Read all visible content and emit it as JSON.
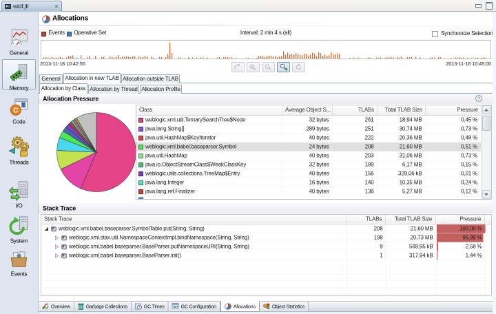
{
  "window": {
    "tab_title": "wldf.jfr"
  },
  "sidebar": {
    "items": [
      {
        "label": "General",
        "selected": false
      },
      {
        "label": "Memory",
        "selected": true
      },
      {
        "label": "Code",
        "selected": false
      },
      {
        "label": "Threads",
        "selected": false
      },
      {
        "label": "I/O",
        "selected": false
      },
      {
        "label": "System",
        "selected": false
      },
      {
        "label": "Events",
        "selected": false
      }
    ]
  },
  "header": {
    "title": "Allocations"
  },
  "timeline": {
    "events_label": "Events",
    "operative_set_label": "Operative Set",
    "interval_label": "Interval: 2 min 4 s (all)",
    "synchronize_label": "Synchronize Selection",
    "synchronize_checked": false,
    "start_time": "2013-11-18 10:42:55",
    "end_time": "2013-11-18 10:45:00",
    "events_color": "#b5443a",
    "operative_set_color": "#4a7ab5",
    "spike_color": "#dc6c2b"
  },
  "page_tabs": [
    {
      "label": "General",
      "selected": false
    },
    {
      "label": "Allocation in new TLAB",
      "selected": true
    },
    {
      "label": "Allocation outside TLAB",
      "selected": false
    }
  ],
  "sub_tabs": [
    {
      "label": "Allocation by Class",
      "selected": true
    },
    {
      "label": "Allocation by Thread",
      "selected": false
    },
    {
      "label": "Allocation Profile",
      "selected": false
    }
  ],
  "allocation_pressure": {
    "section_title": "Allocation Pressure",
    "columns": [
      "Class",
      "Average Object S...",
      "TLABs",
      "Total TLAB Size",
      "Pressure"
    ],
    "rows": [
      {
        "class": "weblogic.xml.util.TernarySearchTree$Node",
        "avg": "32 bytes",
        "tlabs": "261",
        "total": "18,94 MB",
        "pressure": "0,45 %",
        "color": "#d6447f",
        "selected": false
      },
      {
        "class": "java.lang.String[]",
        "avg": "289 bytes",
        "tlabs": "251",
        "total": "30,74 MB",
        "pressure": "0,73 %",
        "color": "#8a4fd0",
        "selected": false
      },
      {
        "class": "java.util.HashMap$KeyIterator",
        "avg": "40 bytes",
        "tlabs": "222",
        "total": "20,36 MB",
        "pressure": "0,48 %",
        "color": "#e04343",
        "selected": false
      },
      {
        "class": "weblogic.xml.babel.baseparser.Symbol",
        "avg": "24 bytes",
        "tlabs": "208",
        "total": "21,60 MB",
        "pressure": "0,51 %",
        "color": "#52e052",
        "selected": true
      },
      {
        "class": "java.util.HashMap",
        "avg": "40 bytes",
        "tlabs": "203",
        "total": "31,06 MB",
        "pressure": "0,73 %",
        "color": "#8ce08c",
        "selected": false
      },
      {
        "class": "java.io.ObjectStreamClass$WeakClassKey",
        "avg": "32 bytes",
        "tlabs": "189",
        "total": "6,17 MB",
        "pressure": "0,15 %",
        "color": "#4dbf6b",
        "selected": false
      },
      {
        "class": "weblogic.utils.collections.TreeMap$Entry",
        "avg": "40 bytes",
        "tlabs": "156",
        "total": "329,06 kB",
        "pressure": "0,01 %",
        "color": "#7a3fbf",
        "selected": false
      },
      {
        "class": "java.lang.Integer",
        "avg": "16 bytes",
        "tlabs": "140",
        "total": "10,35 MB",
        "pressure": "0,24 %",
        "color": "#4fe0c9",
        "selected": false
      },
      {
        "class": "java.lang.ref.Finalizer",
        "avg": "40 bytes",
        "tlabs": "136",
        "total": "5,27 MB",
        "pressure": "0,12 %",
        "color": "#cc3b3b",
        "selected": false
      }
    ],
    "partial_row_color": "#4a90d9",
    "pie": {
      "slices": [
        {
          "pct": 56.5,
          "color": "#e44387"
        },
        {
          "pct": 11.4,
          "color": "#e444a8"
        },
        {
          "pct": 7.8,
          "color": "#c2e250"
        },
        {
          "pct": 5.3,
          "color": "#49d7ed"
        },
        {
          "pct": 3.0,
          "color": "#4de755"
        },
        {
          "pct": 2.0,
          "color": "#4966b5"
        },
        {
          "pct": 1.7,
          "color": "#7a44c9"
        },
        {
          "pct": 1.2,
          "color": "#c03a3a"
        },
        {
          "pct": 1.0,
          "color": "#40c9a5"
        },
        {
          "pct": 0.9,
          "color": "#d8589e"
        },
        {
          "pct": 0.8,
          "color": "#88b039"
        },
        {
          "pct": 8.4,
          "color": "#c0c0c0"
        }
      ]
    }
  },
  "stack_trace": {
    "section_title": "Stack Trace",
    "columns": [
      "Stack Trace",
      "TLABs",
      "Total TLAB Size",
      "Pressure"
    ],
    "bar_color": "#c46060",
    "rows": [
      {
        "method": "weblogic.xml.babel.baseparser.SymbolTable.put(String, String)",
        "tlabs": "208",
        "total": "21,60 MB",
        "pressure": "100,00 %",
        "expanded": true,
        "indent": 0
      },
      {
        "method": "weblogic.xml.stax.util.NamespaceContextImpl.bindNamespace(String, String)",
        "tlabs": "198",
        "total": "20,73 MB",
        "pressure": "95,99 %",
        "expanded": false,
        "indent": 1
      },
      {
        "method": "weblogic.xml.babel.baseparser.BaseParser.putNamespaceURI(String, String)",
        "tlabs": "9",
        "total": "569,95 kB",
        "pressure": "2,58 %",
        "expanded": false,
        "indent": 1
      },
      {
        "method": "weblogic.xml.babel.baseparser.BaseParser.init()",
        "tlabs": "1",
        "total": "317,94 kB",
        "pressure": "1,44 %",
        "expanded": false,
        "indent": 1
      }
    ]
  },
  "bottom_tabs": [
    {
      "label": "Overview",
      "selected": false
    },
    {
      "label": "Garbage Collections",
      "selected": false
    },
    {
      "label": "GC Times",
      "selected": false
    },
    {
      "label": "GC Configuration",
      "selected": false
    },
    {
      "label": "Allocations",
      "selected": true
    },
    {
      "label": "Object Statistics",
      "selected": false
    }
  ]
}
